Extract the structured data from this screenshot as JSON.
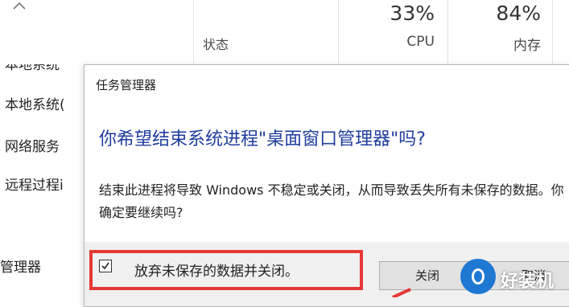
{
  "background": {
    "header": {
      "status_label": "状态",
      "cpu_percent": "33%",
      "cpu_label": "CPU",
      "memory_percent": "84%",
      "memory_label": "内存"
    },
    "processes": [
      {
        "label": "本地系统"
      },
      {
        "label": "本地系统("
      },
      {
        "label": "网络服务"
      },
      {
        "label": "远程过程i"
      },
      {
        "label": "管理器"
      }
    ]
  },
  "dialog": {
    "title": "任务管理器",
    "heading": "你希望结束系统进程\"桌面窗口管理器\"吗?",
    "body": "结束此进程将导致 Windows 不稳定或关闭，从而导致丢失所有未保存的数据。你确定要继续吗?",
    "checkbox_label": "放弃未保存的数据并关闭。",
    "checkbox_checked": true,
    "close_button": "关闭",
    "cancel_button": "取消"
  },
  "watermark": {
    "text": "好装机"
  },
  "colors": {
    "heading": "#1f3d9e",
    "highlight_border": "#e53935",
    "watermark": "#1e78d2"
  }
}
